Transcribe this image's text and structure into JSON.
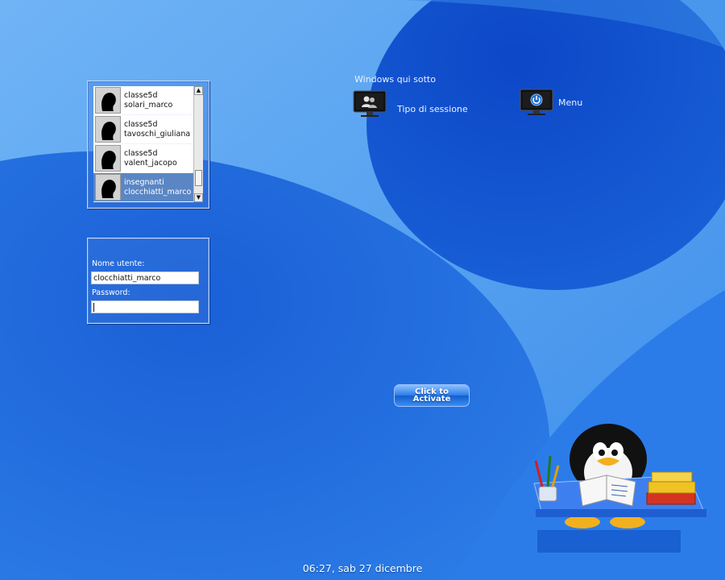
{
  "users": [
    {
      "group": "classe5d",
      "username": "solari_marco",
      "selected": false
    },
    {
      "group": "classe5d",
      "username": "tavoschi_giuliana",
      "selected": false
    },
    {
      "group": "classe5d",
      "username": "valent_jacopo",
      "selected": false
    },
    {
      "group": "insegnanti",
      "username": "clocchiatti_marco",
      "selected": true
    }
  ],
  "login": {
    "username_label": "Nome utente:",
    "username_value": "clocchiatti_marco",
    "password_label": "Password:",
    "password_value": ""
  },
  "session": {
    "caption": "Windows qui sotto",
    "session_type_label": "Tipo di sessione",
    "menu_label": "Menu"
  },
  "activate_button": {
    "line1": "Click to",
    "line2": "Activate"
  },
  "clock": "06:27, sab 27 dicembre",
  "icons": {
    "session": "users-monitor-icon",
    "menu": "power-monitor-icon",
    "avatar": "user-silhouette-icon",
    "mascot": "tux-school-mascot"
  },
  "colors": {
    "background": "#1f6fe0",
    "selected_row": "#5b86c4"
  }
}
